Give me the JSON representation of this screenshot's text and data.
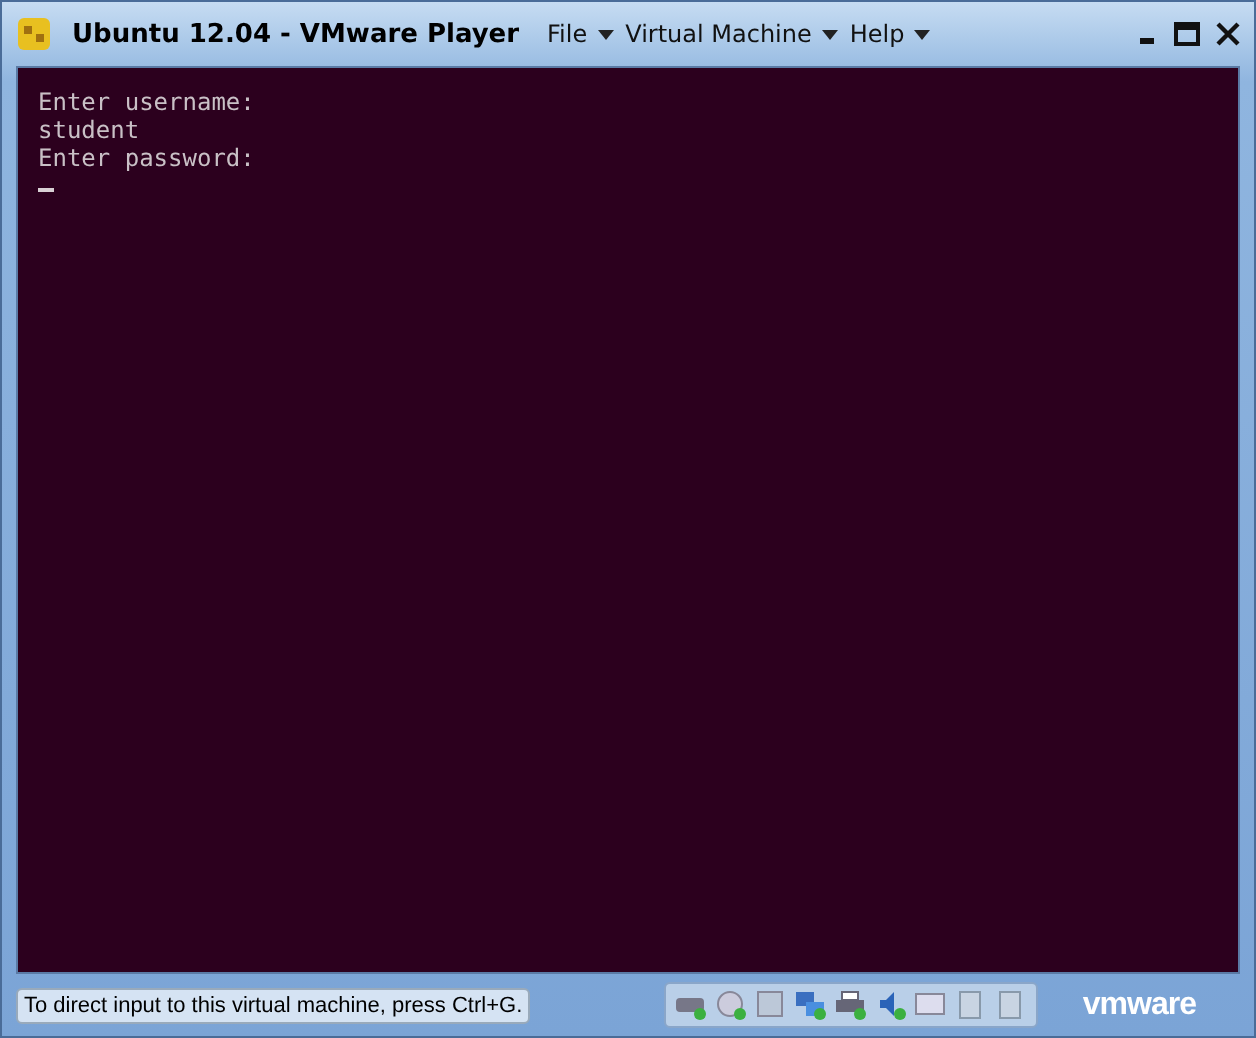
{
  "window": {
    "title": "Ubuntu 12.04 - VMware Player"
  },
  "menu": [
    {
      "label": "File"
    },
    {
      "label": "Virtual Machine"
    },
    {
      "label": "Help"
    }
  ],
  "console": {
    "lines": [
      "Enter username:",
      "student",
      "Enter password:"
    ],
    "cursor": true
  },
  "status_bar": {
    "message": "To direct input to this virtual machine, press Ctrl+G.",
    "devices": [
      {
        "kind": "disk",
        "connected": true
      },
      {
        "kind": "cd",
        "connected": true
      },
      {
        "kind": "floppy",
        "connected": false
      },
      {
        "kind": "network",
        "connected": true
      },
      {
        "kind": "printer",
        "connected": true
      },
      {
        "kind": "sound",
        "connected": true
      },
      {
        "kind": "display",
        "connected": false
      },
      {
        "kind": "blank",
        "connected": false
      },
      {
        "kind": "blank",
        "connected": false
      }
    ],
    "brand": "vmware"
  }
}
